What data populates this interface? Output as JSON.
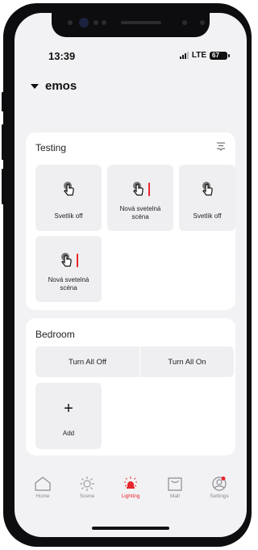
{
  "status": {
    "time": "13:39",
    "network": "LTE",
    "battery": "67"
  },
  "home": {
    "name": "emos"
  },
  "rooms": [
    {
      "title": "Testing",
      "tiles": [
        {
          "label": "Svetlík off"
        },
        {
          "label": "Nová svetelná scéna"
        },
        {
          "label": "Svetlík off"
        },
        {
          "label": "Nová svetelná scéna"
        }
      ]
    },
    {
      "title": "Bedroom",
      "buttons": [
        "Turn All Off",
        "Turn All On"
      ],
      "add_label": "Add"
    }
  ],
  "tabs": [
    {
      "label": "Home",
      "icon": "home-icon"
    },
    {
      "label": "Scene",
      "icon": "sun-icon"
    },
    {
      "label": "Lighting",
      "icon": "bulb-icon",
      "active": true
    },
    {
      "label": "Mall",
      "icon": "bag-icon"
    },
    {
      "label": "Settings",
      "icon": "user-icon"
    }
  ],
  "colors": {
    "accent": "#e8262e",
    "background": "#f2f2f4",
    "card": "#ffffff",
    "tile": "#efeff1"
  }
}
